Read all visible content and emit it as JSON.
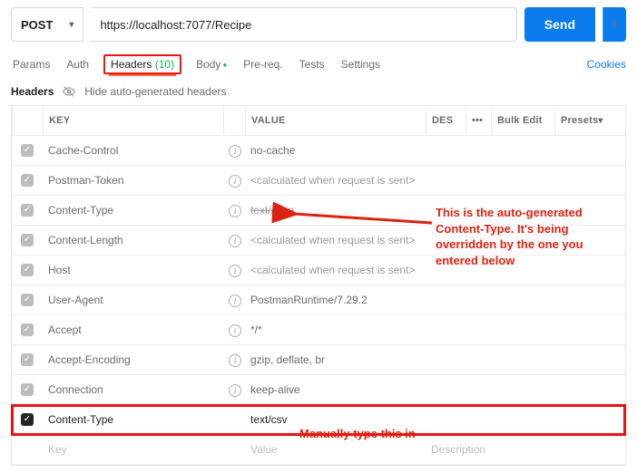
{
  "request": {
    "method": "POST",
    "url": "https://localhost:7077/Recipe",
    "send_label": "Send"
  },
  "tabs": {
    "items": [
      {
        "label": "Params"
      },
      {
        "label": "Auth"
      },
      {
        "label": "Headers",
        "count": "(10)",
        "active": true
      },
      {
        "label": "Body",
        "dot": true
      },
      {
        "label": "Pre-req."
      },
      {
        "label": "Tests"
      },
      {
        "label": "Settings"
      }
    ],
    "cookies": "Cookies"
  },
  "subheader": {
    "title": "Headers",
    "hide_auto": "Hide auto-generated headers"
  },
  "columns": {
    "key": "KEY",
    "value": "VALUE",
    "desc": "DES",
    "more": "•••",
    "bulk": "Bulk Edit",
    "presets": "Presets"
  },
  "headers": [
    {
      "checked": true,
      "auto": true,
      "key": "Cache-Control",
      "value": "no-cache"
    },
    {
      "checked": true,
      "auto": true,
      "key": "Postman-Token",
      "value": "<calculated when request is sent>",
      "calc": true
    },
    {
      "checked": true,
      "auto": true,
      "key": "Content-Type",
      "value": "text/plain",
      "strike": true
    },
    {
      "checked": true,
      "auto": true,
      "key": "Content-Length",
      "value": "<calculated when request is sent>",
      "calc": true
    },
    {
      "checked": true,
      "auto": true,
      "key": "Host",
      "value": "<calculated when request is sent>",
      "calc": true
    },
    {
      "checked": true,
      "auto": true,
      "key": "User-Agent",
      "value": "PostmanRuntime/7.29.2"
    },
    {
      "checked": true,
      "auto": true,
      "key": "Accept",
      "value": "*/*"
    },
    {
      "checked": true,
      "auto": true,
      "key": "Accept-Encoding",
      "value": "gzip, deflate, br"
    },
    {
      "checked": true,
      "auto": true,
      "key": "Connection",
      "value": "keep-alive"
    },
    {
      "checked": true,
      "auto": false,
      "key": "Content-Type",
      "value": "text/csv",
      "highlight": true
    }
  ],
  "placeholders": {
    "key": "Key",
    "value": "Value",
    "desc": "Description"
  },
  "annotations": {
    "main": "This is the auto-generated Content-Type. It's being overridden by the one you entered below",
    "manual": "Manually type this in"
  }
}
